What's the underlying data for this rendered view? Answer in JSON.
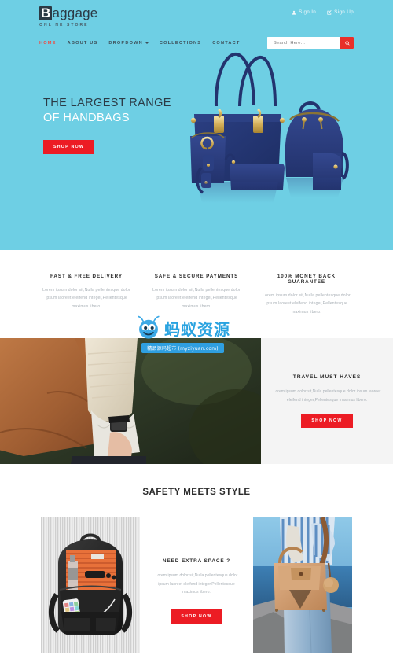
{
  "brand": {
    "name_cap": "B",
    "name_rest": "aggage",
    "tagline": "ONLINE STORE"
  },
  "account": {
    "sign_in": "Sign In",
    "sign_up": "Sign Up"
  },
  "nav": {
    "items": [
      {
        "label": "HOME",
        "active": true
      },
      {
        "label": "ABOUT US",
        "active": false
      },
      {
        "label": "DROPDOWN",
        "active": false,
        "caret": true
      },
      {
        "label": "COLLECTIONS",
        "active": false
      },
      {
        "label": "CONTACT",
        "active": false
      }
    ]
  },
  "search": {
    "placeholder": "Search Here...",
    "value": "",
    "button_icon": "search-icon"
  },
  "hero": {
    "line1": "THE LARGEST RANGE",
    "line2": "OF HANDBAGS",
    "cta": "SHOP NOW",
    "bg_color": "#6ecfe4",
    "image_alt": "navy-blue-handbag-set"
  },
  "features": [
    {
      "title": "FAST & FREE DELIVERY",
      "text": "Lorem ipsum dolor sit,Nulla pellentesque dolor ipsum laoreet eleifend integer,Pellentesque maximus libero."
    },
    {
      "title": "SAFE & SECURE PAYMENTS",
      "text": "Lorem ipsum dolor sit,Nulla pellentesque dolor ipsum laoreet eleifend integer,Pellentesque maximus libero."
    },
    {
      "title": "100% MONEY BACK GUARANTEE",
      "text": "Lorem ipsum dolor sit,Nulla pellentesque dolor ipsum laoreet eleifend integer,Pellentesque maximus libero."
    }
  ],
  "travel": {
    "title": "TRAVEL MUST HAVES",
    "text": "Lorem ipsum dolor sit,Nulla pellentesque dolor ipsum laoreet eleifend integer,Pellentesque maximus libero.",
    "cta": "SHOP NOW",
    "image_alt": "woman-with-brown-leather-bag"
  },
  "safety": {
    "title": "SAFETY MEETS STYLE",
    "left_image_alt": "black-backpack-packed-flatlay",
    "right_image_alt": "woman-with-tan-handbag-by-sea",
    "card": {
      "title": "NEED EXTRA SPACE ?",
      "text": "Lorem ipsum dolor sit,Nulla pellentesque dolor ipsum laoreet eleifend integer,Pellentesque maximus libero.",
      "cta": "SHOP NOW"
    }
  },
  "watermark": {
    "text": "蚂蚁资源",
    "badge": "精品源码超市 (myziyuan.com)"
  },
  "colors": {
    "accent_red": "#ec1c24",
    "hero_blue": "#6ecfe4",
    "dark_text": "#2b3a45",
    "muted_text": "#a9b0b6",
    "watermark_blue": "#29a3e0"
  }
}
